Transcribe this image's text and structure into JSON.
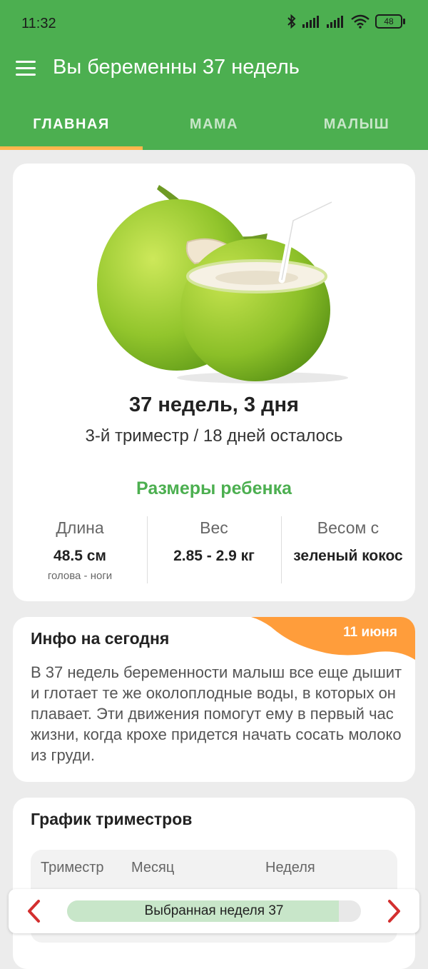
{
  "status_bar": {
    "time": "11:32",
    "battery": "48"
  },
  "header": {
    "title": "Вы беременны 37 недель"
  },
  "tabs": [
    {
      "label": "ГЛАВНАЯ",
      "active": true
    },
    {
      "label": "МАМА",
      "active": false
    },
    {
      "label": "МАЛЫШ",
      "active": false
    }
  ],
  "summary": {
    "image": "green-coconut-icon",
    "weeks": "37 недель, 3 дня",
    "subtitle": "3-й триместр / 18 дней осталось",
    "sizes_title": "Размеры ребенка",
    "length": {
      "label": "Длина",
      "value": "48.5 см",
      "note": "голова - ноги"
    },
    "weight": {
      "label": "Вес",
      "value": "2.85 - 2.9 кг"
    },
    "compare": {
      "label": "Весом с",
      "value": "зеленый кокос"
    }
  },
  "info": {
    "title": "Инфо на сегодня",
    "date": "11 июня",
    "text": "В 37 недель беременности малыш все еще дышит и глотает те же околоплодные воды, в которых он плавает. Эти движения помогут ему в первый час жизни, когда крохе придется начать сосать молоко из груди."
  },
  "trimesters": {
    "title": "График триместров",
    "columns": [
      "Триместр",
      "Месяц",
      "Неделя"
    ]
  },
  "week_selector": {
    "label": "Выбранная неделя 37",
    "progress": 0.925,
    "prev_icon": "chevron-left-icon",
    "next_icon": "chevron-right-icon"
  },
  "colors": {
    "primary": "#4caf50",
    "accent": "#ffb74d",
    "badge": "#ff9d3b",
    "arrow": "#d32f2f",
    "progress_fill": "#c8e6c9"
  }
}
